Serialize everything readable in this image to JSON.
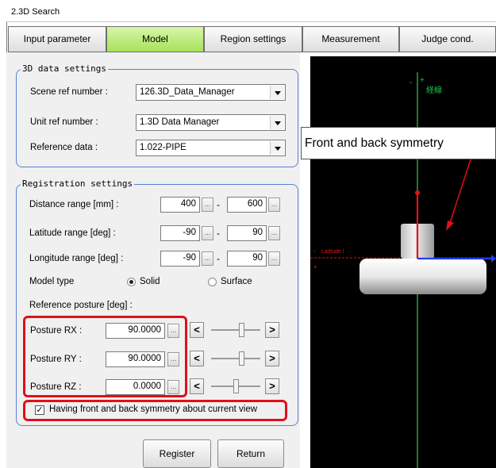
{
  "window": {
    "title": "2.3D Search"
  },
  "tabs": [
    {
      "label": "Input parameter",
      "active": false
    },
    {
      "label": "Model",
      "active": true
    },
    {
      "label": "Region settings",
      "active": false
    },
    {
      "label": "Measurement",
      "active": false
    },
    {
      "label": "Judge cond.",
      "active": false
    }
  ],
  "data_settings": {
    "title": "3D data settings",
    "scene_ref": {
      "label": "Scene ref number :",
      "value": "126.3D_Data_Manager"
    },
    "unit_ref": {
      "label": "Unit ref number :",
      "value": "1.3D Data Manager"
    },
    "reference_data": {
      "label": "Reference data :",
      "value": "1.022-PIPE"
    }
  },
  "registration": {
    "title": "Registration settings",
    "distance": {
      "label": "Distance range [mm] :",
      "min": "400",
      "max": "600"
    },
    "latitude": {
      "label": "Latitude range [deg] :",
      "min": "-90",
      "max": "90"
    },
    "longitude": {
      "label": "Longitude range [deg] :",
      "min": "-90",
      "max": "90"
    },
    "model_type": {
      "label": "Model type",
      "options": [
        "Solid",
        "Surface"
      ],
      "selected": "Solid"
    },
    "ref_posture_label": "Reference posture [deg] :",
    "postures": [
      {
        "label": "Posture RX :",
        "value": "90.0000",
        "slider_level": 0.63
      },
      {
        "label": "Posture RY :",
        "value": "90.0000",
        "slider_level": 0.63
      },
      {
        "label": "Posture RZ :",
        "value": "0.0000",
        "slider_level": 0.5
      }
    ],
    "step_left": "<",
    "step_right": ">",
    "small_button": "...",
    "range_separator": "-",
    "symmetry": {
      "label": "Having front and back symmetry about current view",
      "checked": true,
      "mark": "✓"
    }
  },
  "buttons": {
    "register": "Register",
    "return": "Return"
  },
  "viewer": {
    "callout": "Front and back symmetry",
    "vertical_axis_label": "経線",
    "horizontal_axis_label": "Latitude l",
    "plus_marker": "+",
    "minus_marker": "-",
    "colors": {
      "accent_red": "#e0101a",
      "axis_green": "#22c04a",
      "axis_blue": "#1f3cff",
      "axis_red": "#e01515"
    }
  }
}
